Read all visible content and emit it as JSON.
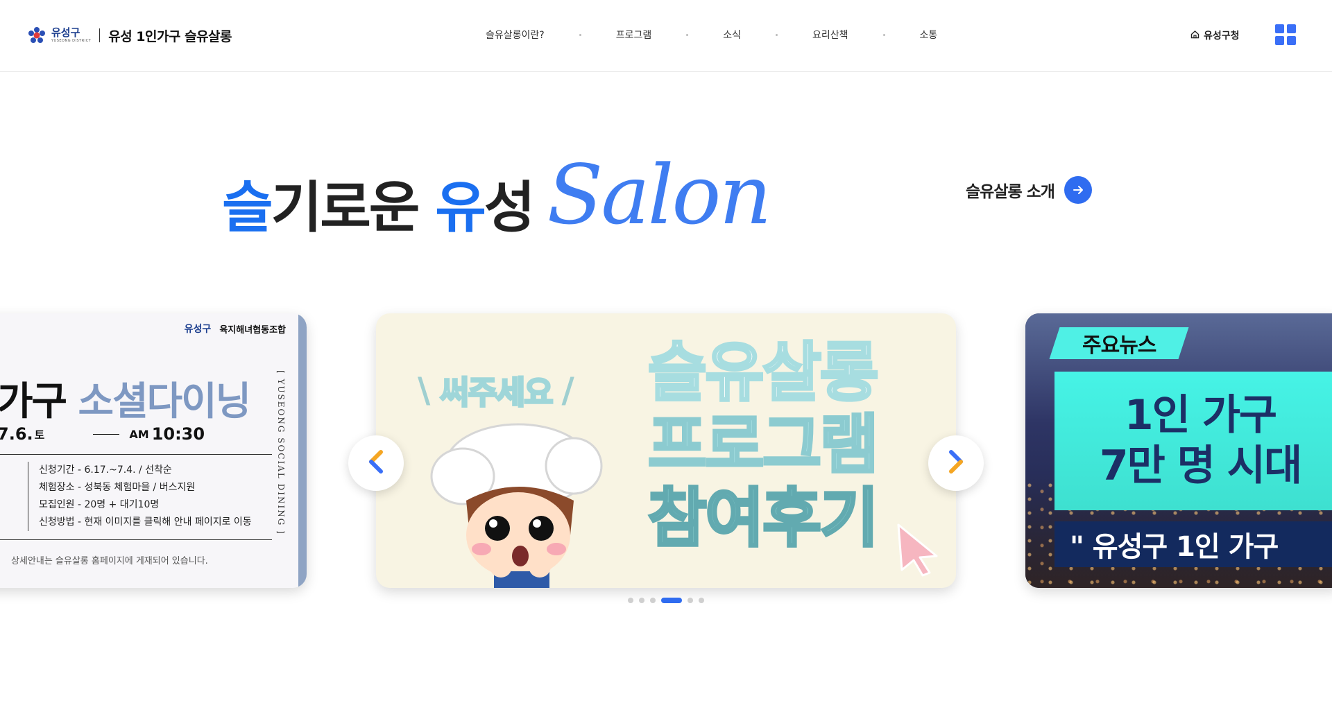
{
  "header": {
    "logo": {
      "gu": "유성구",
      "gu_en": "YUSEONG DISTRICT",
      "title": "유성 1인가구 슬유살롱"
    },
    "nav": [
      "슬유살롱이란?",
      "프로그램",
      "소식",
      "요리산책",
      "소통"
    ],
    "home_link": "유성구청",
    "home_icon": "home-icon",
    "menu_icon": "grid-menu-icon"
  },
  "hero": {
    "part1_blue": "슬",
    "part1_rest": "기로운 ",
    "part2_blue": "유",
    "part2_rest": "성",
    "salon": "Salon",
    "intro_label": "슬유살롱 소개",
    "intro_icon": "arrow-right-icon"
  },
  "slides": {
    "left": {
      "logo_gu": "유성구",
      "coop": "육지해녀협동조합",
      "title_dark": "가구 ",
      "title_blue": "소셜다이닝",
      "date": "7.6.",
      "dow": "토",
      "ampm": "AM",
      "time": "10:30",
      "details": [
        "신청기간  -  6.17.~7.4. / 선착순",
        "체험장소  -  성북동 체험마을 / 버스지원",
        "모집인원  -  20명 + 대기10명",
        "신청방법  -  현재 이미지를 클릭해 안내 페이지로 이동"
      ],
      "notice": "상세안내는 슬유살롱 홈페이지에 게재되어 있습니다.",
      "vertical": "[ YUSEONG SOCIAL DINING ]"
    },
    "center": {
      "badge": "써주세요",
      "line1": "슬유살롱",
      "line2": "프로그램",
      "line3": "참여후기"
    },
    "right": {
      "tag": "주요뉴스",
      "line1": "1인 가구",
      "line2": "7만 명 시대",
      "bar": "\" 유성구 1인 가구"
    }
  },
  "slider": {
    "prev_icon": "chevron-left-icon",
    "next_icon": "chevron-right-icon",
    "dot_count": 6,
    "active_dot": 4
  },
  "colors": {
    "accent": "#2f6cf0",
    "brand_blue": "#1a6ff0",
    "teal": "#4ff0e5"
  }
}
